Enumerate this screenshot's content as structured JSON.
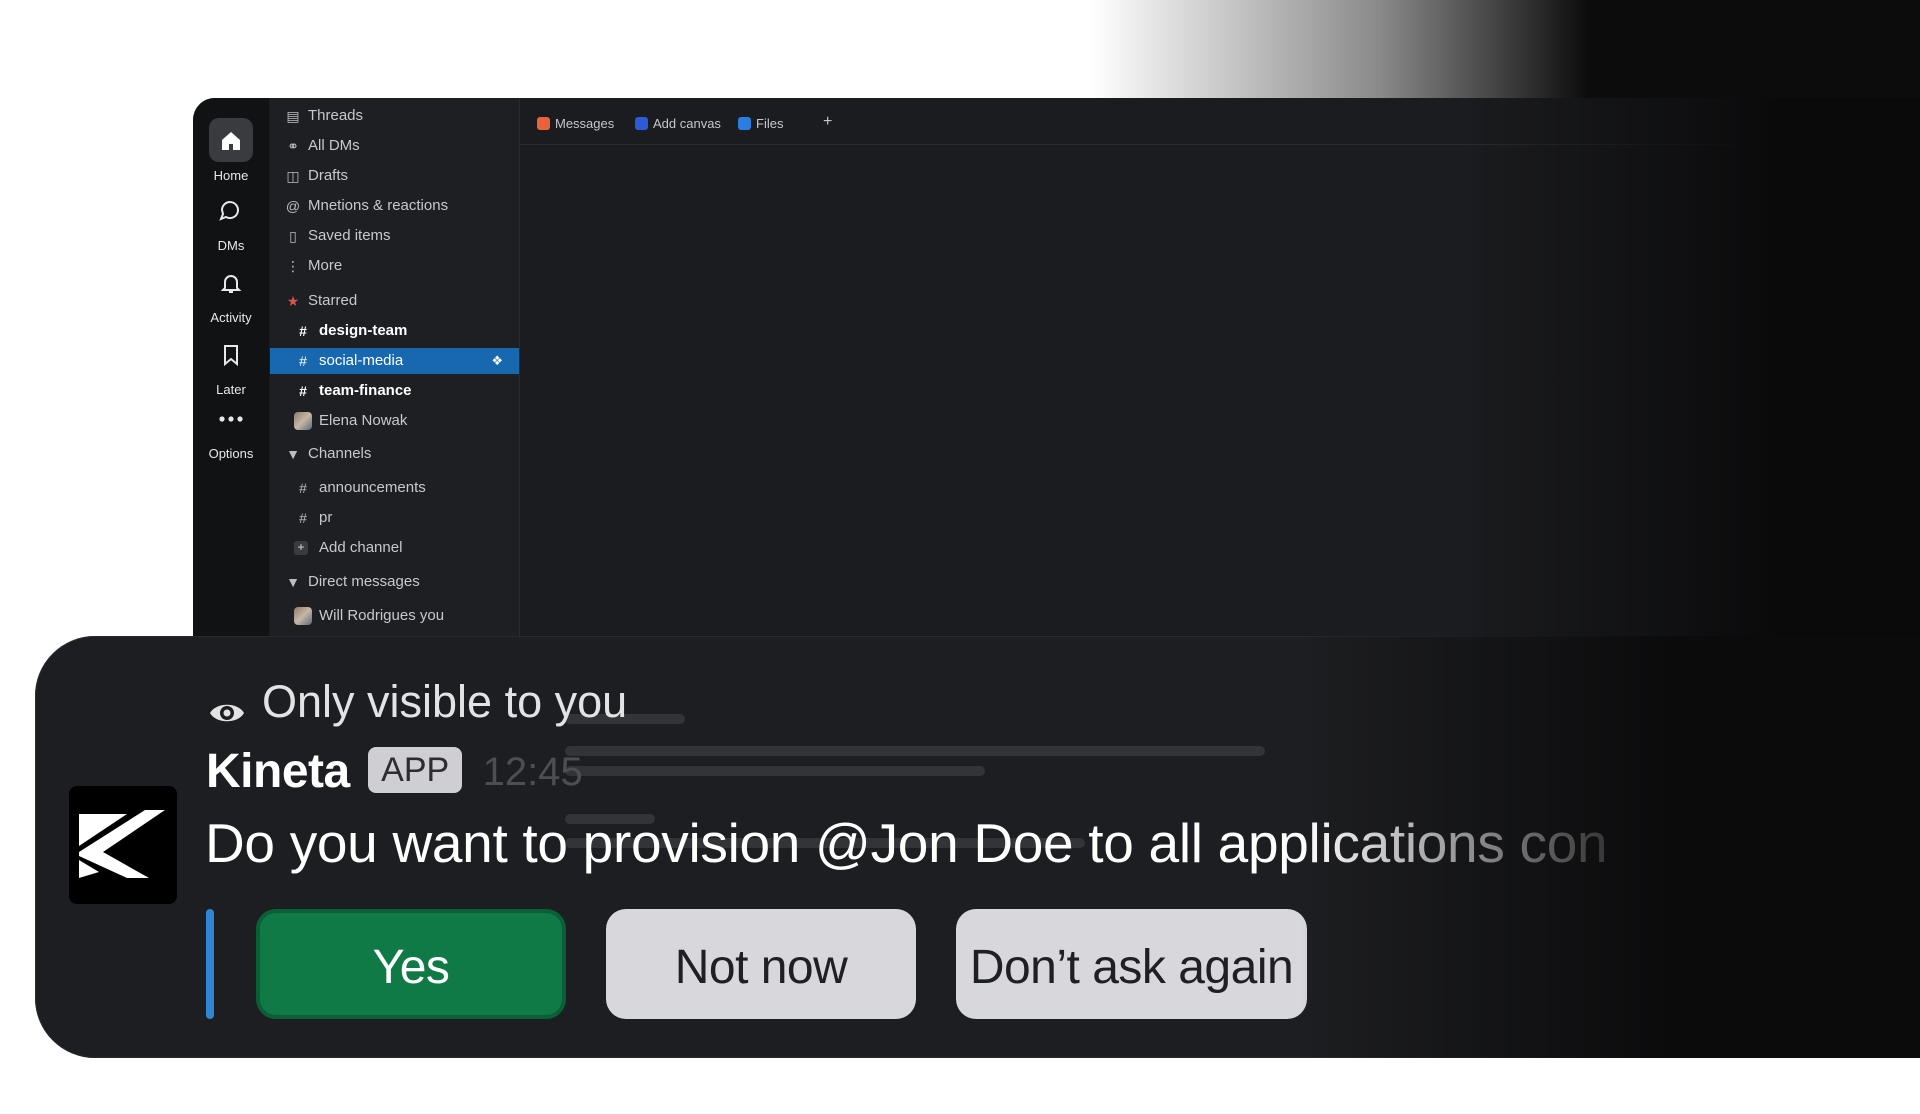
{
  "rail": {
    "items": [
      {
        "label": "Home",
        "icon": "home-icon"
      },
      {
        "label": "DMs",
        "icon": "chat-bubbles-icon"
      },
      {
        "label": "Activity",
        "icon": "bell-icon"
      },
      {
        "label": "Later",
        "icon": "bookmark-icon"
      },
      {
        "label": "Options",
        "icon": "more-horizontal-icon"
      }
    ]
  },
  "sidebar": {
    "nav": [
      {
        "label": "Threads",
        "icon": "threads-icon"
      },
      {
        "label": "All DMs",
        "icon": "dms-icon"
      },
      {
        "label": "Drafts",
        "icon": "drafts-icon"
      },
      {
        "label": "Mnetions & reactions",
        "icon": "at-icon"
      },
      {
        "label": "Saved items",
        "icon": "bookmark-icon"
      },
      {
        "label": "More",
        "icon": "more-vertical-icon"
      }
    ],
    "starred_label": "Starred",
    "starred": [
      {
        "label": "design-team"
      },
      {
        "label": "social-media"
      },
      {
        "label": "team-finance"
      },
      {
        "label": "Elena Nowak"
      }
    ],
    "channels_label": "Channels",
    "channels": [
      {
        "label": "announcements"
      },
      {
        "label": "pr"
      }
    ],
    "add_channel": "Add channel",
    "dms_label": "Direct messages",
    "dms": [
      {
        "label": "Will Rodrigues you"
      }
    ]
  },
  "tabs": [
    {
      "label": "Messages",
      "color": "#e8633a"
    },
    {
      "label": "Add canvas",
      "color": "#2d5bd6"
    },
    {
      "label": "Files",
      "color": "#2b7de0"
    }
  ],
  "tab_add": "+",
  "notification": {
    "visibility": "Only visible to you",
    "app_name": "Kineta",
    "app_badge": "APP",
    "time": "12:45",
    "message": "Do you want to provision @Jon Doe to all applications confirm",
    "buttons": {
      "yes": "Yes",
      "not_now": "Not now",
      "dont_ask": "Don’t ask again"
    },
    "colors": {
      "yes": "#0f7a45",
      "accent_bar": "#2f86d4",
      "secondary": "#d8d8dc"
    }
  }
}
